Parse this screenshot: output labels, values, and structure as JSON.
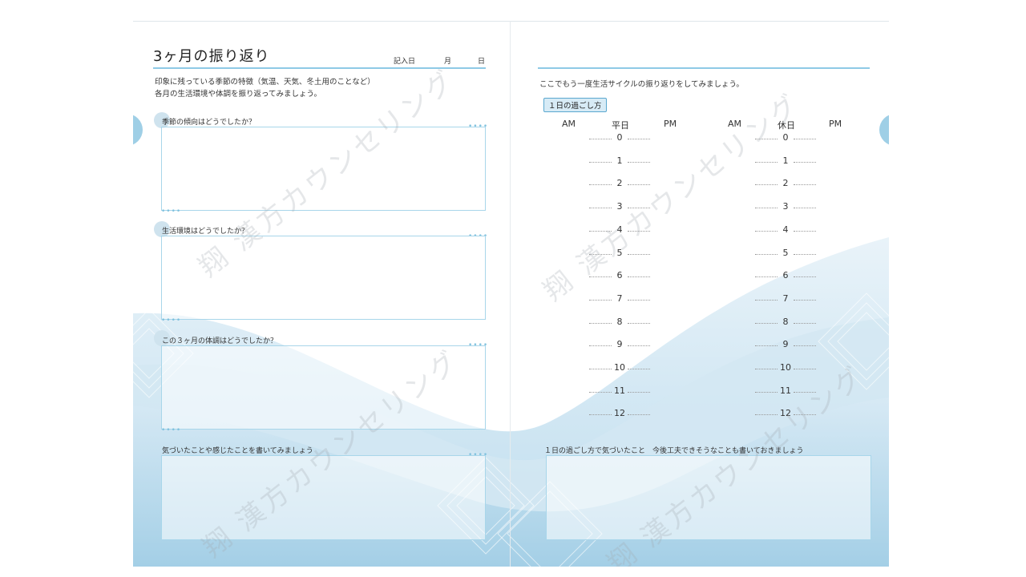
{
  "left": {
    "title": "3ヶ月の振り返り",
    "date": {
      "prefix": "記入日",
      "month": "月",
      "day": "日"
    },
    "intro": [
      "印象に残っている季節の特徴（気温、天気、冬土用のことなど）",
      "各月の生活環境や体調を振り返ってみましょう。"
    ],
    "questions": [
      "季節の傾向はどうでしたか？",
      "生活環境はどうでしたか？",
      "この３ヶ月の体調はどうでしたか？",
      "気づいたことや感じたことを書いてみましょう"
    ]
  },
  "right": {
    "intro": "ここでもう一度生活サイクルの振り返りをしてみましょう。",
    "badge": "１日の過ごし方",
    "weekday": {
      "am": "AM",
      "label": "平日",
      "pm": "PM"
    },
    "holiday": {
      "am": "AM",
      "label": "休日",
      "pm": "PM"
    },
    "hours": [
      "0",
      "1",
      "2",
      "3",
      "4",
      "5",
      "6",
      "7",
      "8",
      "9",
      "10",
      "11",
      "12"
    ],
    "note_prompt": "１日の過ごし方で気づいたこと　今後工夫できそうなことも書いておきましょう"
  },
  "watermark": "翔 漢方カウンセリング",
  "colors": {
    "accent": "#8ecae6",
    "wave": "#b7d9ec"
  }
}
